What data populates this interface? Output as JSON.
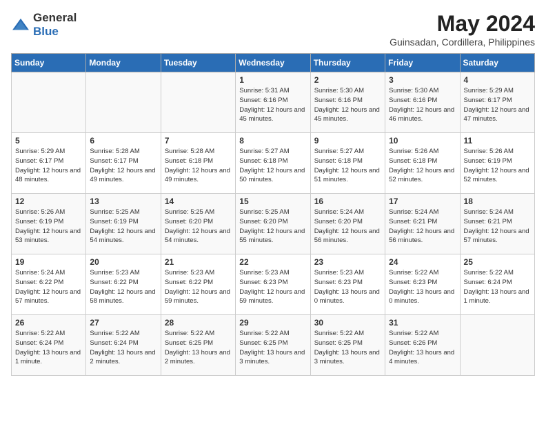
{
  "logo": {
    "general": "General",
    "blue": "Blue"
  },
  "title": {
    "month_year": "May 2024",
    "location": "Guinsadan, Cordillera, Philippines"
  },
  "weekdays": [
    "Sunday",
    "Monday",
    "Tuesday",
    "Wednesday",
    "Thursday",
    "Friday",
    "Saturday"
  ],
  "weeks": [
    [
      {
        "day": "",
        "sunrise": "",
        "sunset": "",
        "daylight": ""
      },
      {
        "day": "",
        "sunrise": "",
        "sunset": "",
        "daylight": ""
      },
      {
        "day": "",
        "sunrise": "",
        "sunset": "",
        "daylight": ""
      },
      {
        "day": "1",
        "sunrise": "Sunrise: 5:31 AM",
        "sunset": "Sunset: 6:16 PM",
        "daylight": "Daylight: 12 hours and 45 minutes."
      },
      {
        "day": "2",
        "sunrise": "Sunrise: 5:30 AM",
        "sunset": "Sunset: 6:16 PM",
        "daylight": "Daylight: 12 hours and 45 minutes."
      },
      {
        "day": "3",
        "sunrise": "Sunrise: 5:30 AM",
        "sunset": "Sunset: 6:16 PM",
        "daylight": "Daylight: 12 hours and 46 minutes."
      },
      {
        "day": "4",
        "sunrise": "Sunrise: 5:29 AM",
        "sunset": "Sunset: 6:17 PM",
        "daylight": "Daylight: 12 hours and 47 minutes."
      }
    ],
    [
      {
        "day": "5",
        "sunrise": "Sunrise: 5:29 AM",
        "sunset": "Sunset: 6:17 PM",
        "daylight": "Daylight: 12 hours and 48 minutes."
      },
      {
        "day": "6",
        "sunrise": "Sunrise: 5:28 AM",
        "sunset": "Sunset: 6:17 PM",
        "daylight": "Daylight: 12 hours and 49 minutes."
      },
      {
        "day": "7",
        "sunrise": "Sunrise: 5:28 AM",
        "sunset": "Sunset: 6:18 PM",
        "daylight": "Daylight: 12 hours and 49 minutes."
      },
      {
        "day": "8",
        "sunrise": "Sunrise: 5:27 AM",
        "sunset": "Sunset: 6:18 PM",
        "daylight": "Daylight: 12 hours and 50 minutes."
      },
      {
        "day": "9",
        "sunrise": "Sunrise: 5:27 AM",
        "sunset": "Sunset: 6:18 PM",
        "daylight": "Daylight: 12 hours and 51 minutes."
      },
      {
        "day": "10",
        "sunrise": "Sunrise: 5:26 AM",
        "sunset": "Sunset: 6:18 PM",
        "daylight": "Daylight: 12 hours and 52 minutes."
      },
      {
        "day": "11",
        "sunrise": "Sunrise: 5:26 AM",
        "sunset": "Sunset: 6:19 PM",
        "daylight": "Daylight: 12 hours and 52 minutes."
      }
    ],
    [
      {
        "day": "12",
        "sunrise": "Sunrise: 5:26 AM",
        "sunset": "Sunset: 6:19 PM",
        "daylight": "Daylight: 12 hours and 53 minutes."
      },
      {
        "day": "13",
        "sunrise": "Sunrise: 5:25 AM",
        "sunset": "Sunset: 6:19 PM",
        "daylight": "Daylight: 12 hours and 54 minutes."
      },
      {
        "day": "14",
        "sunrise": "Sunrise: 5:25 AM",
        "sunset": "Sunset: 6:20 PM",
        "daylight": "Daylight: 12 hours and 54 minutes."
      },
      {
        "day": "15",
        "sunrise": "Sunrise: 5:25 AM",
        "sunset": "Sunset: 6:20 PM",
        "daylight": "Daylight: 12 hours and 55 minutes."
      },
      {
        "day": "16",
        "sunrise": "Sunrise: 5:24 AM",
        "sunset": "Sunset: 6:20 PM",
        "daylight": "Daylight: 12 hours and 56 minutes."
      },
      {
        "day": "17",
        "sunrise": "Sunrise: 5:24 AM",
        "sunset": "Sunset: 6:21 PM",
        "daylight": "Daylight: 12 hours and 56 minutes."
      },
      {
        "day": "18",
        "sunrise": "Sunrise: 5:24 AM",
        "sunset": "Sunset: 6:21 PM",
        "daylight": "Daylight: 12 hours and 57 minutes."
      }
    ],
    [
      {
        "day": "19",
        "sunrise": "Sunrise: 5:24 AM",
        "sunset": "Sunset: 6:22 PM",
        "daylight": "Daylight: 12 hours and 57 minutes."
      },
      {
        "day": "20",
        "sunrise": "Sunrise: 5:23 AM",
        "sunset": "Sunset: 6:22 PM",
        "daylight": "Daylight: 12 hours and 58 minutes."
      },
      {
        "day": "21",
        "sunrise": "Sunrise: 5:23 AM",
        "sunset": "Sunset: 6:22 PM",
        "daylight": "Daylight: 12 hours and 59 minutes."
      },
      {
        "day": "22",
        "sunrise": "Sunrise: 5:23 AM",
        "sunset": "Sunset: 6:23 PM",
        "daylight": "Daylight: 12 hours and 59 minutes."
      },
      {
        "day": "23",
        "sunrise": "Sunrise: 5:23 AM",
        "sunset": "Sunset: 6:23 PM",
        "daylight": "Daylight: 13 hours and 0 minutes."
      },
      {
        "day": "24",
        "sunrise": "Sunrise: 5:22 AM",
        "sunset": "Sunset: 6:23 PM",
        "daylight": "Daylight: 13 hours and 0 minutes."
      },
      {
        "day": "25",
        "sunrise": "Sunrise: 5:22 AM",
        "sunset": "Sunset: 6:24 PM",
        "daylight": "Daylight: 13 hours and 1 minute."
      }
    ],
    [
      {
        "day": "26",
        "sunrise": "Sunrise: 5:22 AM",
        "sunset": "Sunset: 6:24 PM",
        "daylight": "Daylight: 13 hours and 1 minute."
      },
      {
        "day": "27",
        "sunrise": "Sunrise: 5:22 AM",
        "sunset": "Sunset: 6:24 PM",
        "daylight": "Daylight: 13 hours and 2 minutes."
      },
      {
        "day": "28",
        "sunrise": "Sunrise: 5:22 AM",
        "sunset": "Sunset: 6:25 PM",
        "daylight": "Daylight: 13 hours and 2 minutes."
      },
      {
        "day": "29",
        "sunrise": "Sunrise: 5:22 AM",
        "sunset": "Sunset: 6:25 PM",
        "daylight": "Daylight: 13 hours and 3 minutes."
      },
      {
        "day": "30",
        "sunrise": "Sunrise: 5:22 AM",
        "sunset": "Sunset: 6:25 PM",
        "daylight": "Daylight: 13 hours and 3 minutes."
      },
      {
        "day": "31",
        "sunrise": "Sunrise: 5:22 AM",
        "sunset": "Sunset: 6:26 PM",
        "daylight": "Daylight: 13 hours and 4 minutes."
      },
      {
        "day": "",
        "sunrise": "",
        "sunset": "",
        "daylight": ""
      }
    ]
  ]
}
